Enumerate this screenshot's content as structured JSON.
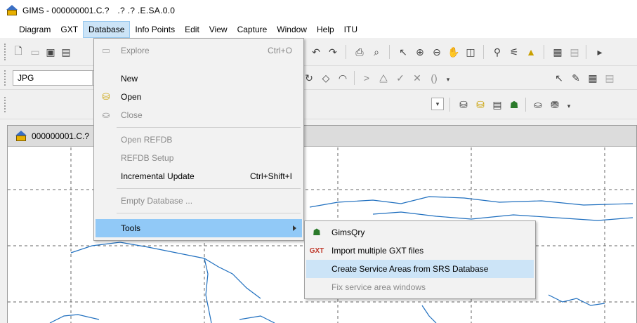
{
  "window": {
    "title": "GIMS - 000000001.C.?",
    "version": ".? .?      .E.SA.0.0"
  },
  "menubar": {
    "items": [
      "Diagram",
      "GXT",
      "Database",
      "Info Points",
      "Edit",
      "View",
      "Capture",
      "Window",
      "Help",
      "ITU"
    ]
  },
  "toolbar": {
    "format_combo": "JPG"
  },
  "mdi_window": {
    "title": "000000001.C.?"
  },
  "database_menu": {
    "explore": {
      "label": "Explore",
      "shortcut": "Ctrl+O"
    },
    "new": {
      "label": "New"
    },
    "open": {
      "label": "Open"
    },
    "close": {
      "label": "Close"
    },
    "open_refdb": {
      "label": "Open REFDB"
    },
    "refdb_setup": {
      "label": "REFDB Setup"
    },
    "incremental_update": {
      "label": "Incremental Update",
      "shortcut": "Ctrl+Shift+I"
    },
    "empty_database": {
      "label": "Empty Database ..."
    },
    "tools": {
      "label": "Tools"
    }
  },
  "tools_menu": {
    "gimsqry": {
      "label": "GimsQry"
    },
    "import_gxt": {
      "label": "Import multiple GXT files"
    },
    "create_service_areas": {
      "label": "Create Service Areas from SRS Database"
    },
    "fix_windows": {
      "label": "Fix service area windows"
    }
  },
  "colors": {
    "menu_highlight": "#91c9f7",
    "menubar_active": "#cce4f7",
    "map_outline": "#1f6fbf"
  }
}
